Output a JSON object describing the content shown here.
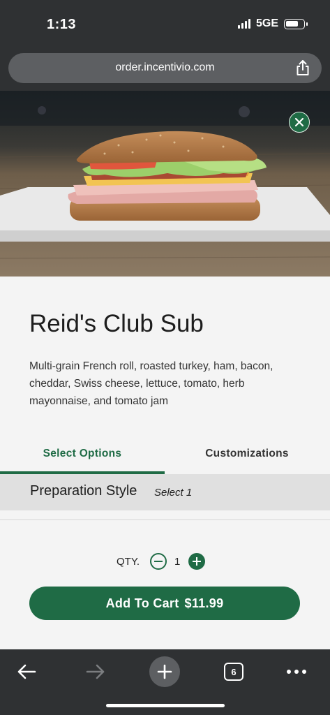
{
  "status_bar": {
    "time": "1:13",
    "network": "5GE"
  },
  "browser": {
    "url": "order.incentivio.com",
    "tab_count": "6"
  },
  "item": {
    "title": "Reid's Club Sub",
    "description": "Multi-grain French roll, roasted turkey, ham, bacon, cheddar, Swiss cheese, lettuce, tomato, herb mayonnaise, and tomato jam",
    "image_icon": "sandwich-photo"
  },
  "tabs": [
    {
      "label": "Select Options",
      "active": true
    },
    {
      "label": "Customizations",
      "active": false
    }
  ],
  "section": {
    "title": "Preparation Style",
    "subtitle": "Select 1"
  },
  "quantity": {
    "label": "QTY.",
    "value": "1"
  },
  "cart": {
    "label": "Add To Cart",
    "price": "$11.99"
  },
  "colors": {
    "accent": "#1f6b45",
    "chrome": "#2f3133",
    "background": "#f4f4f4"
  }
}
